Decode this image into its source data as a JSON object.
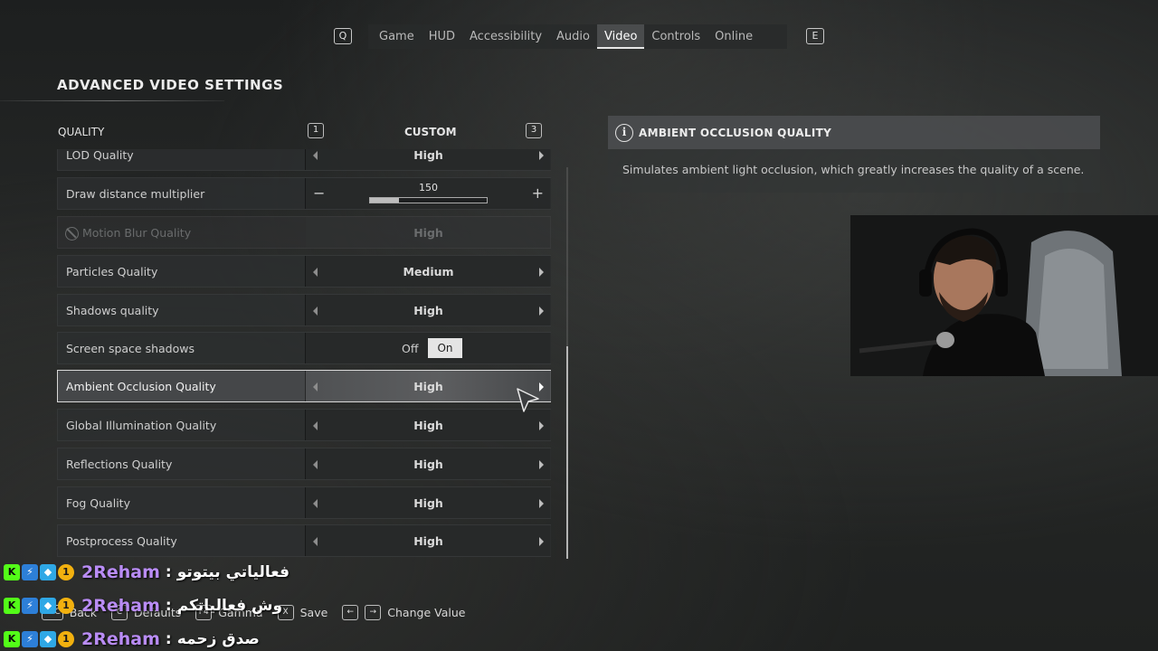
{
  "top_nav": {
    "prev_key": "Q",
    "next_key": "E",
    "tabs": [
      {
        "label": "Game",
        "active": false
      },
      {
        "label": "HUD",
        "active": false
      },
      {
        "label": "Accessibility",
        "active": false
      },
      {
        "label": "Audio",
        "active": false
      },
      {
        "label": "Video",
        "active": true
      },
      {
        "label": "Controls",
        "active": false
      },
      {
        "label": "Online",
        "active": false
      }
    ]
  },
  "page_title": "ADVANCED VIDEO SETTINGS",
  "quality": {
    "label": "QUALITY",
    "prev_key": "1",
    "preset": "CUSTOM",
    "next_key": "3"
  },
  "settings": [
    {
      "label": "LOD Quality",
      "value": "High"
    },
    {
      "label": "Draw distance multiplier",
      "slider_value": "150",
      "slider_fill": 0.25
    },
    {
      "label": "Motion Blur Quality",
      "value": "High",
      "disabled": true
    },
    {
      "label": "Particles Quality",
      "value": "Medium"
    },
    {
      "label": "Shadows quality",
      "value": "High"
    },
    {
      "label": "Screen space shadows",
      "toggle_off": "Off",
      "toggle_on": "On"
    },
    {
      "label": "Ambient Occlusion Quality",
      "value": "High",
      "selected": true
    },
    {
      "label": "Global Illumination Quality",
      "value": "High"
    },
    {
      "label": "Reflections Quality",
      "value": "High"
    },
    {
      "label": "Fog Quality",
      "value": "High"
    },
    {
      "label": "Postprocess Quality",
      "value": "High"
    }
  ],
  "info_panel": {
    "title": "AMBIENT OCCLUSION QUALITY",
    "icon": "info-icon",
    "description": "Simulates ambient light occlusion, which greatly increases the quality of a scene."
  },
  "hints": [
    {
      "key": "ESC",
      "label": "Back"
    },
    {
      "key": "C",
      "label": "Defaults"
    },
    {
      "key": "F4",
      "label": "Gamma"
    },
    {
      "key": "X",
      "label": "Save"
    },
    {
      "key": "←",
      "key2": "→",
      "label": "Change Value"
    }
  ],
  "chat": [
    {
      "user": "2Reham",
      "separator": ":",
      "message": "فعالياتي بيتوتو"
    },
    {
      "user": "2Reham",
      "separator": ":",
      "message": "وش فعالياتكم"
    },
    {
      "user": "2Reham",
      "separator": ":",
      "message": "صدق زحمه"
    }
  ],
  "chat_badges": [
    "K",
    "⚡",
    "◆",
    "1"
  ],
  "colors": {
    "accent": "#e4e4e4",
    "chat_user": "#b98cf5",
    "kick_green": "#53fc18"
  }
}
